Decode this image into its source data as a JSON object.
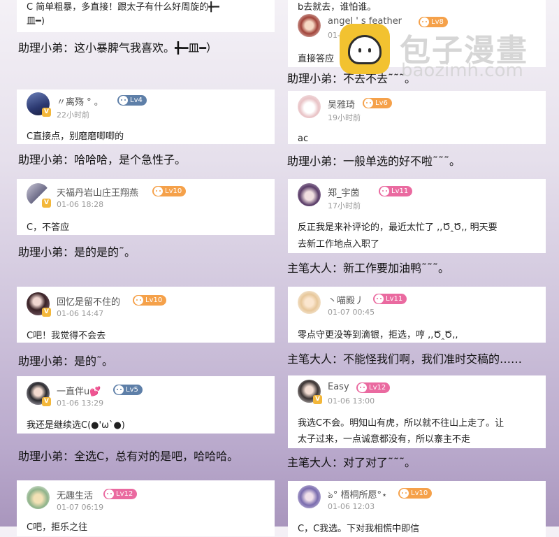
{
  "left_column": [
    {
      "card": {
        "comment_lines": [
          "C 简单粗暴，多直接！跟太子有什么好周旋的╋━",
          "皿━)"
        ]
      },
      "reply": "助理小弟：这小暴脾气我喜欢。╋━皿━）"
    },
    {
      "card": {
        "username": "〃离殇  °  。",
        "time": "22小时前",
        "level": "Lv4",
        "level_color": "#5e7fa8",
        "comment_lines": [
          "C直接点，别磨磨唧唧的"
        ]
      },
      "reply": "助理小弟：哈哈哈，是个急性子。"
    },
    {
      "card": {
        "username": "天福丹岩山庄王翔燕",
        "time": "01-06 18:28",
        "level": "Lv10",
        "level_color": "#f5a14a",
        "comment_lines": [
          "C，不答应"
        ]
      },
      "reply": "助理小弟：是的是的˜。"
    },
    {
      "card": {
        "username": "回忆是留不住的",
        "time": "01-06 14:47",
        "level": "Lv10",
        "level_color": "#f5a14a",
        "comment_lines": [
          "C吧！我觉得不会去"
        ]
      },
      "reply": "助理小弟：是的˜。"
    },
    {
      "card": {
        "username": "一直伴u💕",
        "time": "01-06 13:29",
        "level": "Lv5",
        "level_color": "#5e7fa8",
        "comment_lines": [
          "我还是继续选C(●'ω`●)"
        ]
      },
      "reply": "助理小弟：全选C，总有对的是吧，哈哈哈。"
    },
    {
      "card": {
        "username": "无趣生活",
        "time": "01-07 06:19",
        "level": "Lv12",
        "level_color": "#ea6aa0",
        "comment_lines": [
          "C吧，拒乐之往"
        ]
      }
    }
  ],
  "right_column": [
    {
      "card": {
        "username": "angel ' s feather",
        "time": "01-06",
        "level": "Lv8",
        "level_color": "#f5a14a",
        "top_line": "b去就去，谁怕谁。",
        "comment_lines": [
          "直接答应"
        ]
      },
      "reply": "助理小弟：不去不去˜˜˜。"
    },
    {
      "card": {
        "username": "吴雅琦",
        "time": "19小时前",
        "level": "Lv6",
        "level_color": "#f5a14a",
        "comment_lines": [
          "ac"
        ]
      },
      "reply": "助理小弟：一般单选的好不啦˜˜˜。"
    },
    {
      "card": {
        "username": "郑_宇茵",
        "time": "17小时前",
        "level": "Lv11",
        "level_color": "#ea6aa0",
        "comment_lines": [
          "反正我是来补评论的，最近太忙了 ,,Ծ‸Ծ,, 明天要",
          "去新工作地点入职了"
        ]
      },
      "reply": "主笔大人：新工作要加油鸭˜˜˜。"
    },
    {
      "card": {
        "username": "丶喵殿丿",
        "time": "01-07 00:45",
        "level": "Lv11",
        "level_color": "#ea6aa0",
        "comment_lines": [
          "零点守更没等到滴银，拒选，哼 ,,Ծ‸Ծ,,"
        ]
      },
      "reply": "主笔大人：不能怪我们啊，我们准时交稿的……"
    },
    {
      "card": {
        "username": "Easy",
        "time": "01-06 13:00",
        "level": "Lv12",
        "level_color": "#ea6aa0",
        "comment_lines": [
          "我选C不会。明知山有虎，所以就不往山上走了。让",
          "太子过来，一点诚意都没有，所以寨主不走"
        ]
      },
      "reply": "主笔大人：对了对了˜˜˜。"
    },
    {
      "card": {
        "username": "ঌ° 梧桐所愿°⋆",
        "time": "01-06 12:03",
        "level": "Lv10",
        "level_color": "#f5a14a",
        "comment_lines": [
          "C，C我选。下对我相慌中即信"
        ]
      }
    }
  ],
  "watermark": {
    "title": "包子漫畫",
    "url": "baozimh.com"
  }
}
